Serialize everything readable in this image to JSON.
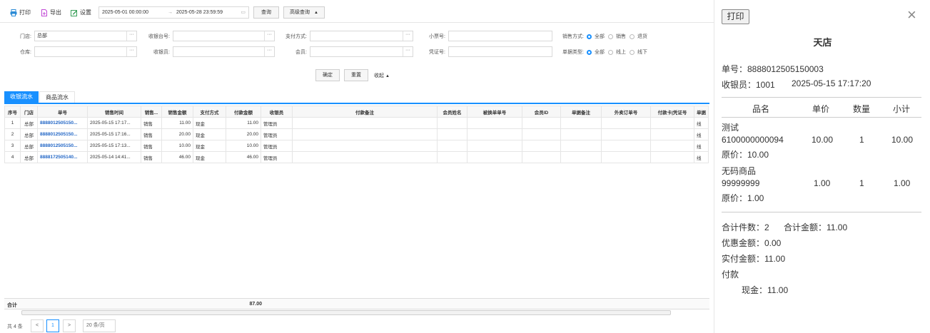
{
  "toolbar": {
    "print": "打印",
    "export": "导出",
    "settings": "设置"
  },
  "date": {
    "start": "2025-05-01 00:00:00",
    "sep": "→",
    "end": "2025-05-28 23:59:59"
  },
  "buttons": {
    "query": "查询",
    "advanced": "高级查询",
    "confirm": "确定",
    "reset": "重置",
    "collapse": "收起"
  },
  "filters": {
    "store_label": "门店:",
    "store_value": "总部",
    "register_label": "收银台号:",
    "pay_label": "支付方式:",
    "ticket_label": "小票号:",
    "sale_mode_label": "销售方式:",
    "sale_modes": [
      "全部",
      "销售",
      "退货"
    ],
    "warehouse_label": "仓库:",
    "cashier_label": "收银员:",
    "member_label": "会员:",
    "voucher_label": "凭证号:",
    "doc_type_label": "单据类型:",
    "doc_types": [
      "全部",
      "线上",
      "线下"
    ],
    "dots": "···"
  },
  "tabs": [
    "收银流水",
    "商品流水"
  ],
  "table": {
    "headers": [
      "序号",
      "门店",
      "单号",
      "销售时间",
      "销售...",
      "销售金额",
      "支付方式",
      "付款金额",
      "收银员",
      "付款备注",
      "会员姓名",
      "被换单单号",
      "会员ID",
      "单据备注",
      "外卖订单号",
      "付款卡|凭证号",
      "单据"
    ],
    "rows": [
      [
        "1",
        "总部",
        "8888012505150...",
        "2025-05-15 17:17...",
        "销售",
        "11.00",
        "现金",
        "11.00",
        "管理员",
        "",
        "",
        "",
        "",
        "",
        "",
        "",
        "线"
      ],
      [
        "2",
        "总部",
        "8888012505150...",
        "2025-05-15 17:16...",
        "销售",
        "20.00",
        "现金",
        "20.00",
        "管理员",
        "",
        "",
        "",
        "",
        "",
        "",
        "",
        "线"
      ],
      [
        "3",
        "总部",
        "8888012505150...",
        "2025-05-15 17:13...",
        "销售",
        "10.00",
        "现金",
        "10.00",
        "管理员",
        "",
        "",
        "",
        "",
        "",
        "",
        "",
        "线"
      ],
      [
        "4",
        "总部",
        "8888172505140...",
        "2025-05-14 14:41...",
        "销售",
        "46.00",
        "现金",
        "46.00",
        "管理员",
        "",
        "",
        "",
        "",
        "",
        "",
        "",
        "线"
      ]
    ],
    "total_label": "合计",
    "total_value": "87.00"
  },
  "pagination": {
    "total": "共 4 条",
    "prev": "<",
    "page": "1",
    "next": ">",
    "size": "20 条/页"
  },
  "receipt": {
    "print_btn": "打印",
    "close": "×",
    "title": "天店",
    "order_no": "单号：8888012505150003",
    "cashier": "收银员：1001",
    "time": "2025-05-15 17:17:20",
    "headers": [
      "品名",
      "单价",
      "数量",
      "小计"
    ],
    "items": [
      {
        "name": "测试",
        "code": "6100000000094",
        "price": "10.00",
        "qty": "1",
        "subtotal": "10.00",
        "orig": "原价：10.00"
      },
      {
        "name": "无码商品",
        "code": "99999999",
        "price": "1.00",
        "qty": "1",
        "subtotal": "1.00",
        "orig": "原价：1.00"
      }
    ],
    "total_count": "合计件数：2",
    "total_amount": "合计金额：11.00",
    "discount": "优惠金额：0.00",
    "paid": "实付金额：11.00",
    "payment": "付款",
    "cash": "现金：11.00"
  },
  "colors": {
    "accent": "#1890ff",
    "link": "#2367c6"
  }
}
